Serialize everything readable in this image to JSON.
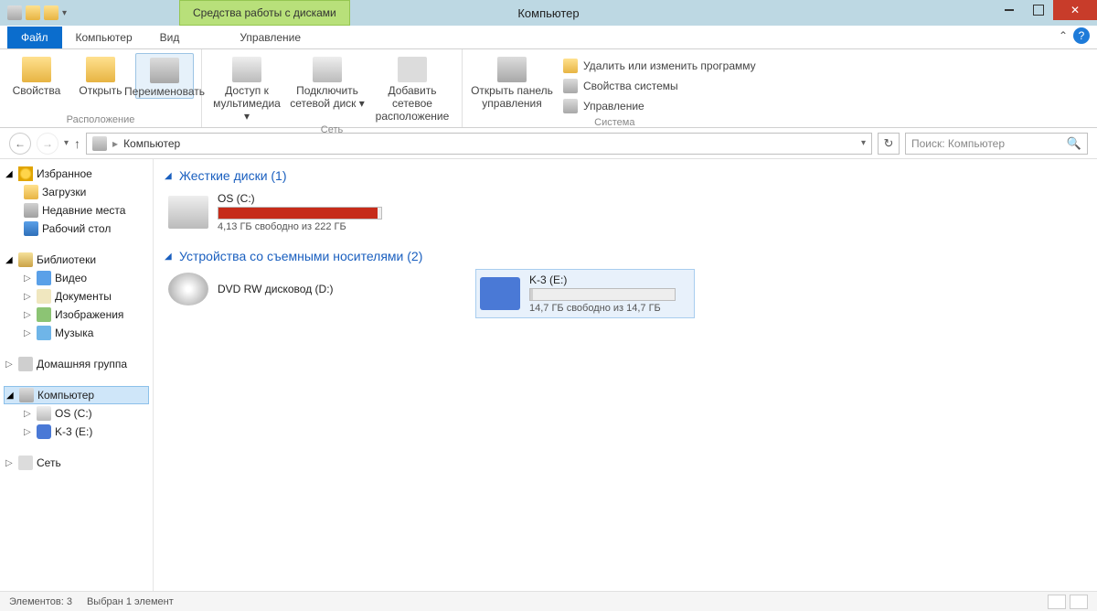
{
  "window": {
    "title": "Компьютер",
    "drive_tools_label": "Средства работы с дисками"
  },
  "tabs": {
    "file": "Файл",
    "computer": "Компьютер",
    "view": "Вид",
    "manage": "Управление"
  },
  "ribbon": {
    "location": {
      "properties": "Свойства",
      "open": "Открыть",
      "rename": "Переименовать",
      "group_label": "Расположение"
    },
    "network": {
      "media_access": "Доступ к мультимедиа ▾",
      "map_drive": "Подключить сетевой диск ▾",
      "add_location": "Добавить сетевое расположение",
      "group_label": "Сеть"
    },
    "cpl": {
      "open_cpl": "Открыть панель управления"
    },
    "system": {
      "uninstall": "Удалить или изменить программу",
      "sys_props": "Свойства системы",
      "manage": "Управление",
      "group_label": "Система"
    }
  },
  "navbar": {
    "path_root": "Компьютер",
    "search_placeholder": "Поиск: Компьютер"
  },
  "sidebar": {
    "favorites": "Избранное",
    "downloads": "Загрузки",
    "recent": "Недавние места",
    "desktop": "Рабочий стол",
    "libraries": "Библиотеки",
    "video": "Видео",
    "documents": "Документы",
    "pictures": "Изображения",
    "music": "Музыка",
    "homegroup": "Домашняя группа",
    "computer": "Компьютер",
    "os_c": "OS (C:)",
    "k3_e": "K-3 (E:)",
    "network": "Сеть"
  },
  "content": {
    "hard_drives_header": "Жесткие диски (1)",
    "removable_header": "Устройства со съемными носителями (2)",
    "os": {
      "name": "OS (C:)",
      "subtext": "4,13 ГБ свободно из 222 ГБ",
      "fill_pct": 98,
      "fill_color": "#c62c1a"
    },
    "dvd": {
      "name": "DVD RW дисковод (D:)"
    },
    "sd": {
      "name": "K-3 (E:)",
      "subtext": "14,7 ГБ свободно из 14,7 ГБ",
      "fill_pct": 2,
      "fill_color": "#d0d0d0"
    }
  },
  "statusbar": {
    "count": "Элементов: 3",
    "selection": "Выбран 1 элемент"
  }
}
